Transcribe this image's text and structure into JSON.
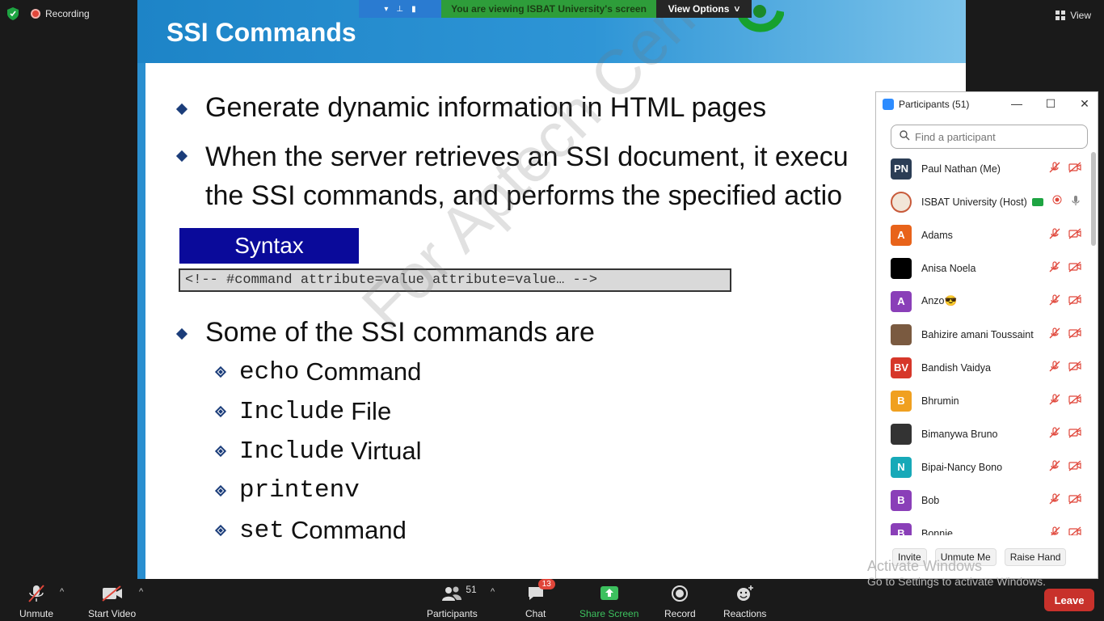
{
  "status": {
    "recording_label": "Recording",
    "view_label": "View"
  },
  "share_bar": {
    "viewing_text": "You are viewing ISBAT University's screen",
    "view_options_label": "View Options"
  },
  "slide": {
    "title": "SSI Commands",
    "bullets": [
      "Generate dynamic information in HTML pages",
      "When the server retrieves an SSI document, it execu",
      "the SSI commands, and performs the specified actio",
      "Some of the SSI commands are"
    ],
    "syntax_heading": "Syntax",
    "syntax_code": "<!-- #command attribute=value attribute=value… -->",
    "sub_items": [
      {
        "mono": "echo",
        "text": "Command"
      },
      {
        "mono": "Include",
        "text": "File"
      },
      {
        "mono": "Include",
        "text": "Virtual"
      },
      {
        "mono": "printenv",
        "text": ""
      },
      {
        "mono": "set",
        "text": "Command"
      }
    ],
    "watermark": "For Aptech Centre Use Only"
  },
  "participants_panel": {
    "title": "Participants (51)",
    "search_placeholder": "Find a participant",
    "participants": [
      {
        "initials": "PN",
        "name": "Paul Nathan (Me)",
        "color": "#2b3d55"
      },
      {
        "initials": "",
        "name": "ISBAT University (Host)",
        "color": "#f2e6d8"
      },
      {
        "initials": "A",
        "name": "Adams",
        "color": "#e8631a"
      },
      {
        "initials": "",
        "name": "Anisa Noela",
        "color": "#000000"
      },
      {
        "initials": "A",
        "name": "Anzo😎",
        "color": "#8a3fb8"
      },
      {
        "initials": "",
        "name": "Bahizire amani Toussaint",
        "color": "#7a5a40"
      },
      {
        "initials": "BV",
        "name": "Bandish Vaidya",
        "color": "#d6372a"
      },
      {
        "initials": "B",
        "name": "Bhrumin",
        "color": "#f0a020"
      },
      {
        "initials": "",
        "name": "Bimanywa Bruno",
        "color": "#333333"
      },
      {
        "initials": "N",
        "name": "Bipai-Nancy Bono",
        "color": "#17a9b8"
      },
      {
        "initials": "B",
        "name": "Bob",
        "color": "#8a3fb8"
      },
      {
        "initials": "B",
        "name": "Bonnie",
        "color": "#8a3fb8"
      }
    ],
    "buttons": {
      "invite": "Invite",
      "unmute_me": "Unmute Me",
      "raise_hand": "Raise Hand"
    }
  },
  "windows_notice": {
    "line1": "Activate Windows",
    "line2": "Go to Settings to activate Windows."
  },
  "toolbar": {
    "unmute": "Unmute",
    "start_video": "Start Video",
    "participants": "Participants",
    "participants_count": "51",
    "chat": "Chat",
    "chat_badge": "13",
    "share_screen": "Share Screen",
    "record": "Record",
    "reactions": "Reactions",
    "leave": "Leave"
  }
}
